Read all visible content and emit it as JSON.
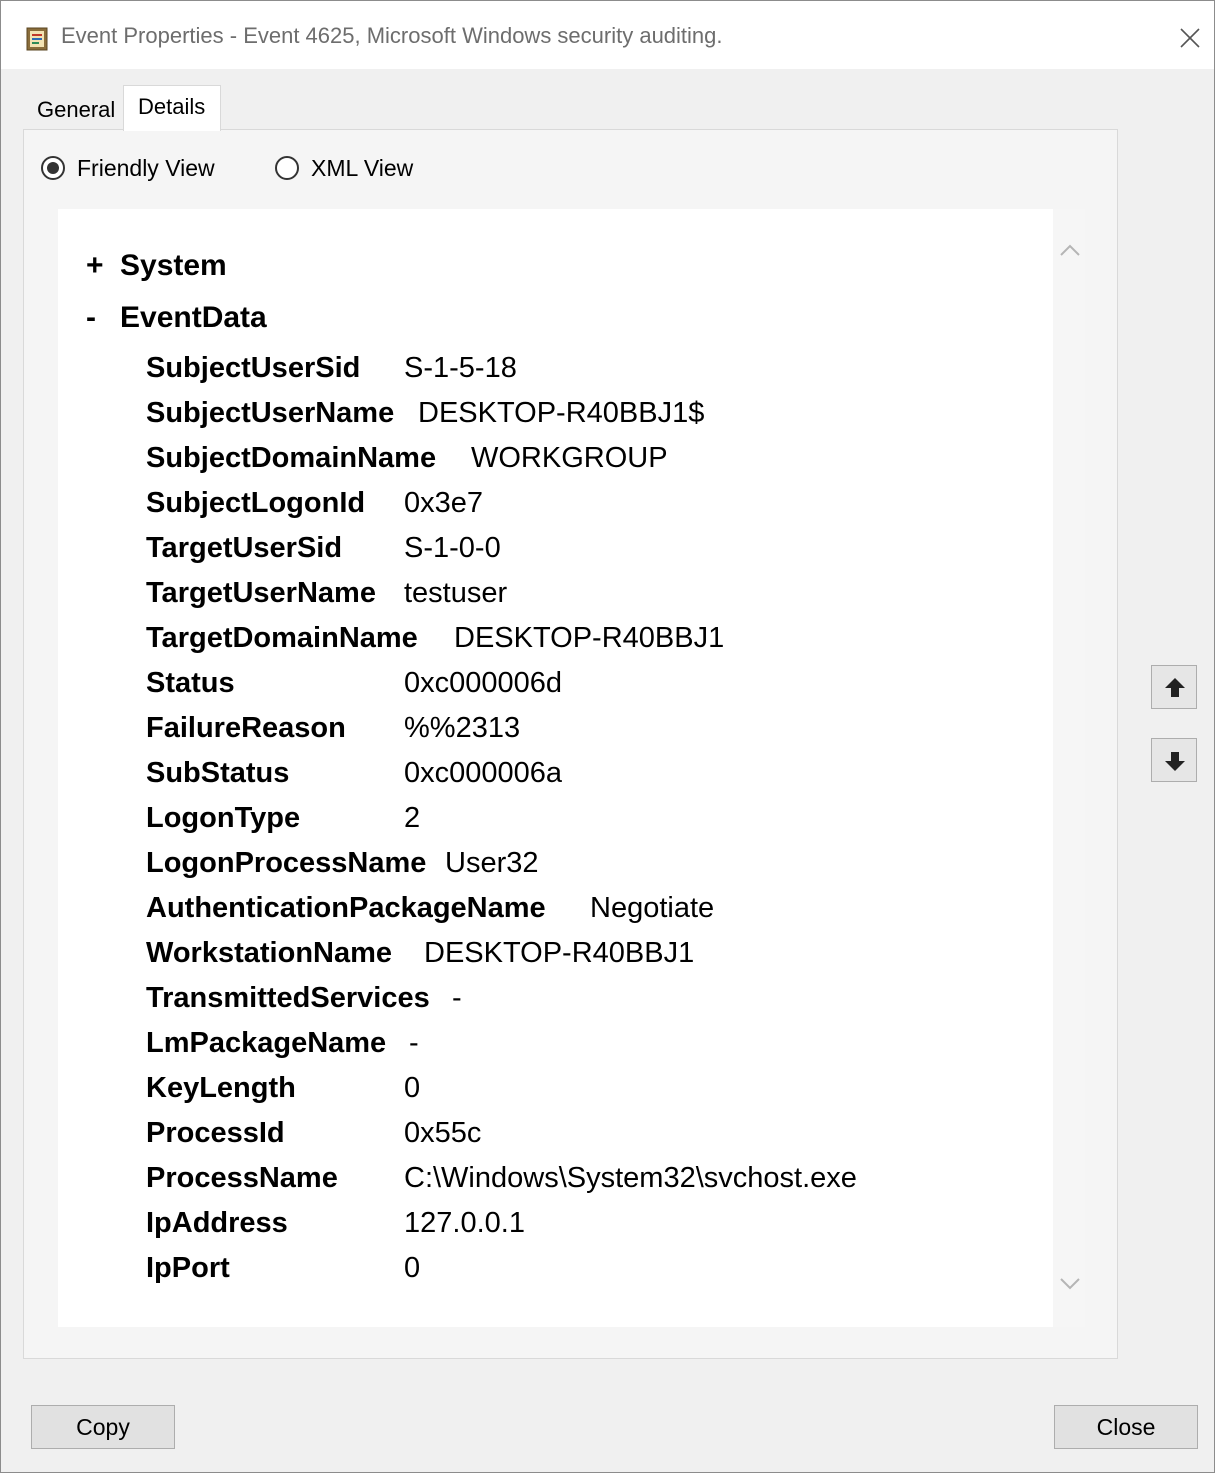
{
  "window": {
    "title": "Event Properties - Event 4625, Microsoft Windows security auditing."
  },
  "tabs": [
    {
      "label": "General",
      "selected": false
    },
    {
      "label": "Details",
      "selected": true
    }
  ],
  "view_options": {
    "friendly": {
      "label": "Friendly View",
      "checked": true
    },
    "xml": {
      "label": "XML View",
      "checked": false
    }
  },
  "tree": {
    "system": {
      "toggle": "+",
      "label": "System"
    },
    "eventdata": {
      "toggle": "-",
      "label": "EventData"
    }
  },
  "event_data": [
    {
      "key": "SubjectUserSid",
      "value": "S-1-5-18"
    },
    {
      "key": "SubjectUserName",
      "value": "DESKTOP-R40BBJ1$"
    },
    {
      "key": "SubjectDomainName",
      "value": "WORKGROUP"
    },
    {
      "key": "SubjectLogonId",
      "value": "0x3e7"
    },
    {
      "key": "TargetUserSid",
      "value": "S-1-0-0"
    },
    {
      "key": "TargetUserName",
      "value": "testuser"
    },
    {
      "key": "TargetDomainName",
      "value": "DESKTOP-R40BBJ1"
    },
    {
      "key": "Status",
      "value": "0xc000006d"
    },
    {
      "key": "FailureReason",
      "value": "%%2313"
    },
    {
      "key": "SubStatus",
      "value": "0xc000006a"
    },
    {
      "key": "LogonType",
      "value": "2"
    },
    {
      "key": "LogonProcessName",
      "value": "User32"
    },
    {
      "key": "AuthenticationPackageName",
      "value": "Negotiate"
    },
    {
      "key": "WorkstationName",
      "value": "DESKTOP-R40BBJ1"
    },
    {
      "key": "TransmittedServices",
      "value": "-"
    },
    {
      "key": "LmPackageName",
      "value": "-"
    },
    {
      "key": "KeyLength",
      "value": "0"
    },
    {
      "key": "ProcessId",
      "value": "0x55c"
    },
    {
      "key": "ProcessName",
      "value": "C:\\Windows\\System32\\svchost.exe"
    },
    {
      "key": "IpAddress",
      "value": "127.0.0.1"
    },
    {
      "key": "IpPort",
      "value": "0"
    }
  ],
  "buttons": {
    "copy": "Copy",
    "close": "Close"
  },
  "icons": {
    "app": "event-viewer-icon",
    "close": "close-icon",
    "scroll_up": "chevron-up-icon",
    "scroll_down": "chevron-down-icon",
    "prev_event": "arrow-up-icon",
    "next_event": "arrow-down-icon"
  }
}
